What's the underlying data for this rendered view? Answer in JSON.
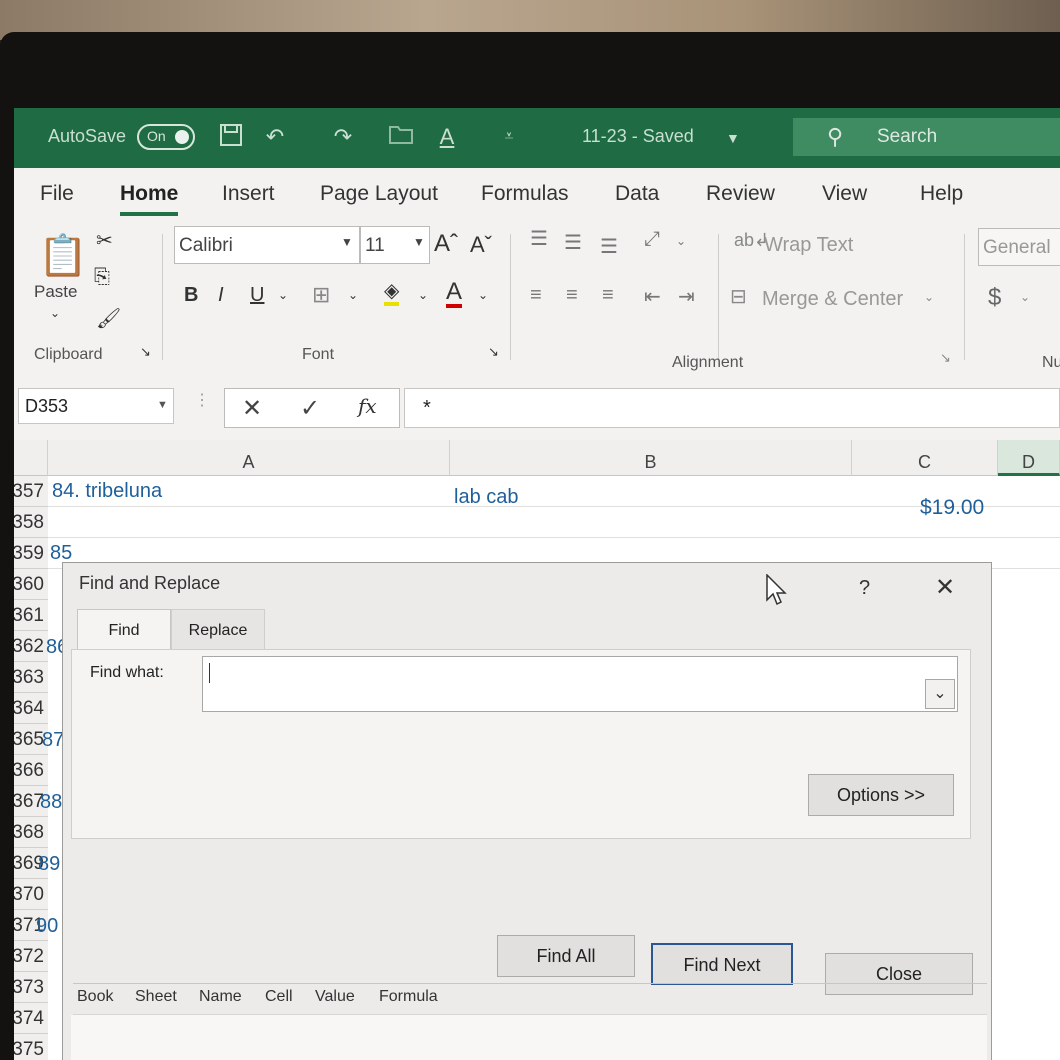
{
  "titlebar": {
    "autosave_label": "AutoSave",
    "autosave_state": "On",
    "doc_title": "11-23  -  Saved",
    "search_label": "Search",
    "icons": [
      "save-icon",
      "undo-icon",
      "redo-icon",
      "open-icon",
      "font-color-icon",
      "customize-icon"
    ]
  },
  "tabs": [
    "File",
    "Home",
    "Insert",
    "Page Layout",
    "Formulas",
    "Data",
    "Review",
    "View",
    "Help"
  ],
  "ribbon": {
    "paste_label": "Paste",
    "clipboard_label": "Clipboard",
    "font_name": "Calibri",
    "font_size": "11",
    "font_group_label": "Font",
    "bold": "B",
    "italic": "I",
    "underline": "U",
    "wrap_text": "Wrap Text",
    "merge_center": "Merge & Center",
    "alignment_label": "Alignment",
    "number_format": "General",
    "currency": "$",
    "number_group_label": "Nu"
  },
  "formula_bar": {
    "name_box": "D353",
    "fx": "fx",
    "content": "*"
  },
  "grid": {
    "columns": [
      "A",
      "B",
      "C",
      "D"
    ],
    "rows": [
      "357",
      "358",
      "359",
      "360",
      "361",
      "362",
      "363",
      "364",
      "365",
      "366",
      "367",
      "368",
      "369",
      "370",
      "371",
      "372",
      "373",
      "374",
      "375"
    ],
    "cells": {
      "a357": "84. tribeluna",
      "b357": "lab cab",
      "c357": "$19.00",
      "a359": "85",
      "a362": "86",
      "a365": "87",
      "a367": "88",
      "a369": "89",
      "a371": "90"
    }
  },
  "dialog": {
    "title": "Find and Replace",
    "help": "?",
    "close_glyph": "✕",
    "tab_find": "Find",
    "tab_replace": "Replace",
    "find_what_label": "Find what:",
    "find_what_value": "",
    "options_button": "Options >>",
    "find_all_button": "Find All",
    "find_next_button": "Find Next",
    "close_button": "Close",
    "results_columns": [
      "Book",
      "Sheet",
      "Name",
      "Cell",
      "Value",
      "Formula"
    ]
  }
}
